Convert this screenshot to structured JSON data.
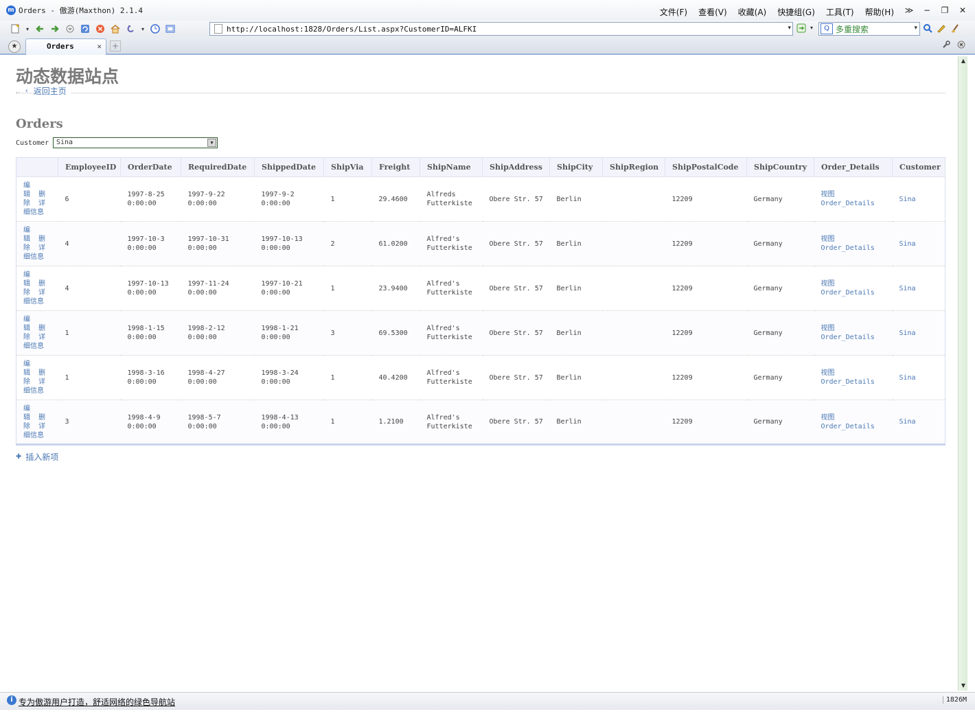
{
  "window": {
    "title": "Orders - 傲游(Maxthon) 2.1.4",
    "logo": "m",
    "menu": [
      "文件(F)",
      "查看(V)",
      "收藏(A)",
      "快捷组(G)",
      "工具(T)",
      "帮助(H)"
    ],
    "controls": [
      "≫",
      "−",
      "❐",
      "✕"
    ]
  },
  "toolbar": {
    "address": "http://localhost:1828/Orders/List.aspx?CustomerID=ALFKI",
    "search_value": "多重搜索",
    "search_engine": "Q"
  },
  "tabs": [
    {
      "label": "Orders"
    }
  ],
  "page": {
    "site_title": "动态数据站点",
    "back_link": "返回主页",
    "heading": "Orders",
    "filter_label": "Customer",
    "filter_value": "Sina",
    "insert_link": "插入新项",
    "actions": {
      "edit": [
        "编",
        "辑"
      ],
      "delete": [
        "删",
        "除"
      ],
      "details": [
        "详",
        "细信息"
      ]
    }
  },
  "grid": {
    "columns": [
      "",
      "EmployeeID",
      "OrderDate",
      "RequiredDate",
      "ShippedDate",
      "ShipVia",
      "Freight",
      "ShipName",
      "ShipAddress",
      "ShipCity",
      "ShipRegion",
      "ShipPostalCode",
      "ShipCountry",
      "Order_Details",
      "Customer"
    ],
    "rows": [
      {
        "EmployeeID": "6",
        "OrderDate": [
          "1997-8-25",
          "0:00:00"
        ],
        "RequiredDate": [
          "1997-9-22",
          "0:00:00"
        ],
        "ShippedDate": [
          "1997-9-2",
          "0:00:00"
        ],
        "ShipVia": "1",
        "Freight": "29.4600",
        "ShipName": [
          "Alfreds",
          "Futterkiste"
        ],
        "ShipAddress": "Obere Str. 57",
        "ShipCity": "Berlin",
        "ShipRegion": "",
        "ShipPostalCode": "12209",
        "ShipCountry": "Germany",
        "Order_Details": [
          "视图",
          "Order_Details"
        ],
        "Customer": "Sina"
      },
      {
        "EmployeeID": "4",
        "OrderDate": [
          "1997-10-3",
          "0:00:00"
        ],
        "RequiredDate": [
          "1997-10-31",
          "0:00:00"
        ],
        "ShippedDate": [
          "1997-10-13",
          "0:00:00"
        ],
        "ShipVia": "2",
        "Freight": "61.0200",
        "ShipName": [
          "Alfred's",
          "Futterkiste"
        ],
        "ShipAddress": "Obere Str. 57",
        "ShipCity": "Berlin",
        "ShipRegion": "",
        "ShipPostalCode": "12209",
        "ShipCountry": "Germany",
        "Order_Details": [
          "视图",
          "Order_Details"
        ],
        "Customer": "Sina"
      },
      {
        "EmployeeID": "4",
        "OrderDate": [
          "1997-10-13",
          "0:00:00"
        ],
        "RequiredDate": [
          "1997-11-24",
          "0:00:00"
        ],
        "ShippedDate": [
          "1997-10-21",
          "0:00:00"
        ],
        "ShipVia": "1",
        "Freight": "23.9400",
        "ShipName": [
          "Alfred's",
          "Futterkiste"
        ],
        "ShipAddress": "Obere Str. 57",
        "ShipCity": "Berlin",
        "ShipRegion": "",
        "ShipPostalCode": "12209",
        "ShipCountry": "Germany",
        "Order_Details": [
          "视图",
          "Order_Details"
        ],
        "Customer": "Sina"
      },
      {
        "EmployeeID": "1",
        "OrderDate": [
          "1998-1-15",
          "0:00:00"
        ],
        "RequiredDate": [
          "1998-2-12",
          "0:00:00"
        ],
        "ShippedDate": [
          "1998-1-21",
          "0:00:00"
        ],
        "ShipVia": "3",
        "Freight": "69.5300",
        "ShipName": [
          "Alfred's",
          "Futterkiste"
        ],
        "ShipAddress": "Obere Str. 57",
        "ShipCity": "Berlin",
        "ShipRegion": "",
        "ShipPostalCode": "12209",
        "ShipCountry": "Germany",
        "Order_Details": [
          "视图",
          "Order_Details"
        ],
        "Customer": "Sina"
      },
      {
        "EmployeeID": "1",
        "OrderDate": [
          "1998-3-16",
          "0:00:00"
        ],
        "RequiredDate": [
          "1998-4-27",
          "0:00:00"
        ],
        "ShippedDate": [
          "1998-3-24",
          "0:00:00"
        ],
        "ShipVia": "1",
        "Freight": "40.4200",
        "ShipName": [
          "Alfred's",
          "Futterkiste"
        ],
        "ShipAddress": "Obere Str. 57",
        "ShipCity": "Berlin",
        "ShipRegion": "",
        "ShipPostalCode": "12209",
        "ShipCountry": "Germany",
        "Order_Details": [
          "视图",
          "Order_Details"
        ],
        "Customer": "Sina"
      },
      {
        "EmployeeID": "3",
        "OrderDate": [
          "1998-4-9",
          "0:00:00"
        ],
        "RequiredDate": [
          "1998-5-7",
          "0:00:00"
        ],
        "ShippedDate": [
          "1998-4-13",
          "0:00:00"
        ],
        "ShipVia": "1",
        "Freight": "1.2100",
        "ShipName": [
          "Alfred's",
          "Futterkiste"
        ],
        "ShipAddress": "Obere Str. 57",
        "ShipCity": "Berlin",
        "ShipRegion": "",
        "ShipPostalCode": "12209",
        "ShipCountry": "Germany",
        "Order_Details": [
          "视图",
          "Order_Details"
        ],
        "Customer": "Sina"
      }
    ]
  },
  "status": {
    "text": "专为傲游用户打造，舒适网络的绿色导航站",
    "memory": "1826M"
  },
  "colors": {
    "link": "#4b78b3",
    "heading": "#7a7a7a",
    "header_bg": "#f3f4fb"
  }
}
